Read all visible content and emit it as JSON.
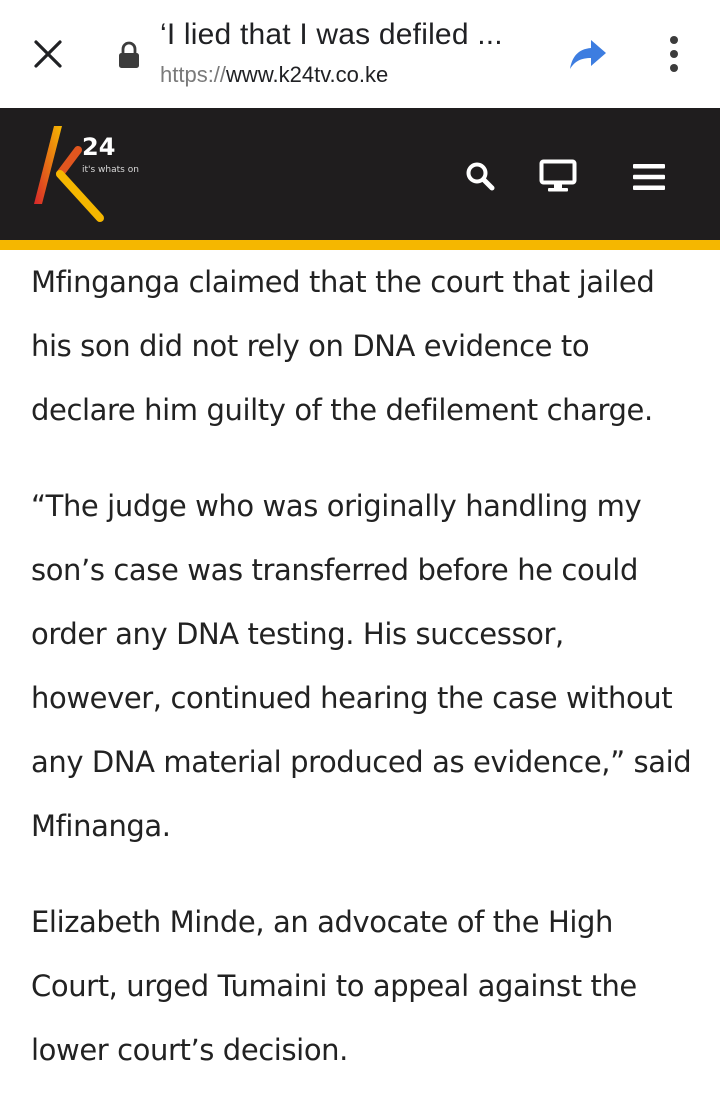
{
  "browser": {
    "title": "‘I lied that I was defiled ...",
    "url_scheme": "https://",
    "url_host": "www.k24tv.co.ke"
  },
  "site": {
    "logo_text": "24",
    "tagline": "it's whats on",
    "colors": {
      "header_bg": "#1f1d1e",
      "accent": "#f5b700",
      "logo_gradient_start": "#d7262b",
      "logo_gradient_end": "#f5b700"
    },
    "icons": [
      "search-icon",
      "tv-icon",
      "hamburger-menu-icon"
    ]
  },
  "article": {
    "paragraphs": [
      "Mfinganga claimed that the court that jailed his son did not rely on DNA evidence to declare him guilty of the defilement charge.",
      "“The judge who was originally handling my son’s case was transferred before he could order any DNA testing. His successor, however, continued hearing the case without any DNA material produced as evidence,” said Mfinanga.",
      "Elizabeth Minde, an advocate of the High Court, urged Tumaini to appeal against the lower court’s decision."
    ]
  }
}
